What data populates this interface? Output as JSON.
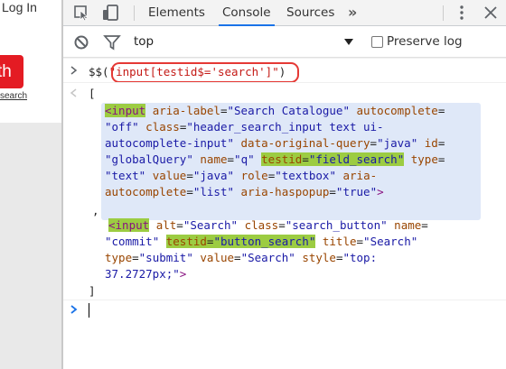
{
  "page": {
    "login_text": "Log In",
    "search_button_text": "th",
    "advanced_link": "search"
  },
  "devtools": {
    "tabs": [
      "Elements",
      "Console",
      "Sources"
    ],
    "active_tab": "Console",
    "more_tabs": "»",
    "filter": {
      "context": "top",
      "preserve_log_label": "Preserve log"
    },
    "console": {
      "prompt_cmd_prefix": "$$(",
      "prompt_cmd_string": "\"input[testid$='search']\"",
      "prompt_cmd_suffix": ")",
      "open_bracket": "[",
      "comma": ",",
      "close_bracket": "]"
    },
    "el1": {
      "tag": "input",
      "a1": "aria-label",
      "v1": "Search Catalogue",
      "a2": "autocomplete",
      "v2": "off",
      "a3": "class",
      "v3": "header_search_input text ui-autocomplete-input",
      "a4": "data-original-query",
      "v4": "java",
      "a5": "id",
      "v5": "globalQuery",
      "a6": "name",
      "v6": "q",
      "a7": "testid",
      "v7": "field_search",
      "a8": "type",
      "v8": "text",
      "a9": "value",
      "v9": "java",
      "a10": "role",
      "v10": "textbox",
      "a11": "aria-autocomplete",
      "v11": "list",
      "a12": "aria-haspopup",
      "v12": "true"
    },
    "el2": {
      "tag": "input",
      "a1": "alt",
      "v1": "Search",
      "a2": "class",
      "v2": "search_button",
      "a3": "name",
      "v3": "commit",
      "a4": "testid",
      "v4": "button_search",
      "a5": "title",
      "v5": "Search",
      "a6": "type",
      "v6": "submit",
      "a7": "value",
      "v7": "Search",
      "a8": "style",
      "v8": "top: 37.2727px;"
    }
  },
  "colors": {
    "accent": "#1a73e8",
    "highlight": "#9ccc42",
    "selection": "#dfe8f8",
    "oval": "#e53935",
    "brand_red": "#e41b23"
  }
}
